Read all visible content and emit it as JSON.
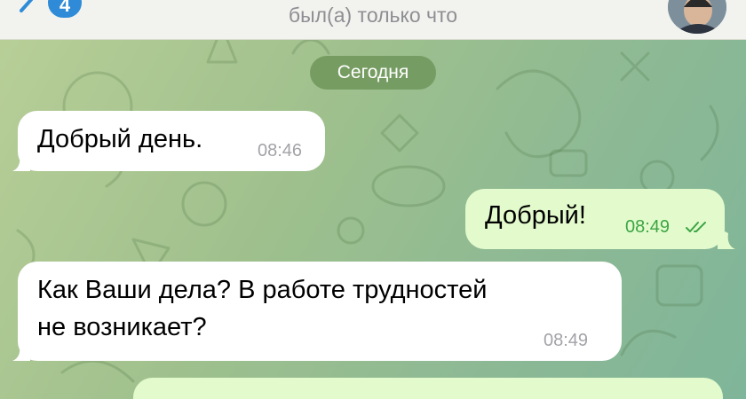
{
  "header": {
    "unread_count": "4",
    "contact_status": "был(а) только что",
    "back_icon": "chevron-left-icon",
    "avatar_icon": "contact-avatar"
  },
  "chat": {
    "date_separator": "Сегодня",
    "messages": [
      {
        "direction": "incoming",
        "text": "Добрый день.",
        "time": "08:46"
      },
      {
        "direction": "outgoing",
        "text": "Добрый!",
        "time": "08:49",
        "status_icon": "double-check-icon"
      },
      {
        "direction": "incoming",
        "text_lines": [
          "Как Ваши дела? В работе трудностей",
          "не возникает?"
        ],
        "time": "08:49"
      }
    ]
  },
  "colors": {
    "accent": "#2f8bd8",
    "incoming_bubble": "#ffffff",
    "outgoing_bubble": "#e3fbcc",
    "read_check": "#3da545",
    "date_pill": "#6a9256"
  }
}
